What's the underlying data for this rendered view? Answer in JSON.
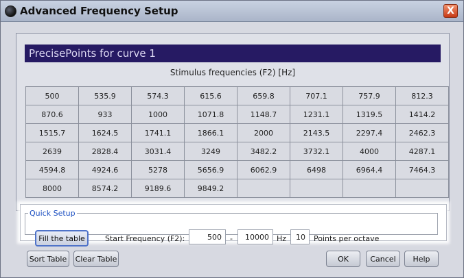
{
  "window": {
    "title": "Advanced Frequency Setup",
    "close_label": "X"
  },
  "panel": {
    "header": "PrecisePoints for curve 1",
    "table_title": "Stimulus frequencies (F2) [Hz]",
    "rows": [
      [
        "500",
        "535.9",
        "574.3",
        "615.6",
        "659.8",
        "707.1",
        "757.9",
        "812.3"
      ],
      [
        "870.6",
        "933",
        "1000",
        "1071.8",
        "1148.7",
        "1231.1",
        "1319.5",
        "1414.2"
      ],
      [
        "1515.7",
        "1624.5",
        "1741.1",
        "1866.1",
        "2000",
        "2143.5",
        "2297.4",
        "2462.3"
      ],
      [
        "2639",
        "2828.4",
        "3031.4",
        "3249",
        "3482.2",
        "3732.1",
        "4000",
        "4287.1"
      ],
      [
        "4594.8",
        "4924.6",
        "5278",
        "5656.9",
        "6062.9",
        "6498",
        "6964.4",
        "7464.3"
      ],
      [
        "8000",
        "8574.2",
        "9189.6",
        "9849.2",
        "",
        "",
        "",
        ""
      ]
    ]
  },
  "quick_setup": {
    "legend": "Quick Setup",
    "fill_button": "Fill the table",
    "start_label": "Start Frequency (F2):",
    "start_value": "500",
    "dash": "-",
    "end_value": "10000",
    "hz_label": "Hz",
    "points_value": "10",
    "points_label": "Points per octave"
  },
  "buttons": {
    "sort": "Sort Table",
    "clear": "Clear Table",
    "ok": "OK",
    "cancel": "Cancel",
    "help": "Help"
  }
}
